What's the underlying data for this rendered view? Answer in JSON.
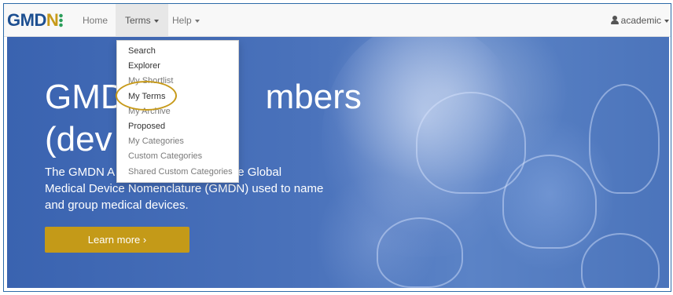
{
  "brand": {
    "text_a": "GMD",
    "text_b": "N"
  },
  "nav": {
    "home": "Home",
    "terms": "Terms",
    "help": "Help"
  },
  "user": {
    "name": "academic"
  },
  "hero": {
    "title_line1": "GMDN Agency members",
    "title_line2": "(devices)",
    "title_visible_line1_a": "GMD",
    "title_visible_line1_b": "mbers",
    "title_visible_line2": "(dev",
    "text_line1_a": "The GMDN A",
    "text_line1_b": "or the Global",
    "text_line2": "Medical Device Nomenclature (GMDN) used to name",
    "text_line3": "and group medical devices.",
    "button": "Learn more ›"
  },
  "terms_menu": {
    "items": [
      {
        "label": "Search",
        "muted": false
      },
      {
        "label": "Explorer",
        "muted": false
      },
      {
        "label": "My Shortlist",
        "muted": true
      },
      {
        "label": "My Terms",
        "muted": false
      },
      {
        "label": "My Archive",
        "muted": true
      },
      {
        "label": "Proposed",
        "muted": false
      },
      {
        "label": "My Categories",
        "muted": true
      },
      {
        "label": "Custom Categories",
        "muted": true
      },
      {
        "label": "Shared Custom Categories",
        "muted": true
      }
    ]
  },
  "colors": {
    "accent": "#c49a18",
    "brand_blue": "#1d4f91",
    "hero_blue": "#3a63b0"
  }
}
